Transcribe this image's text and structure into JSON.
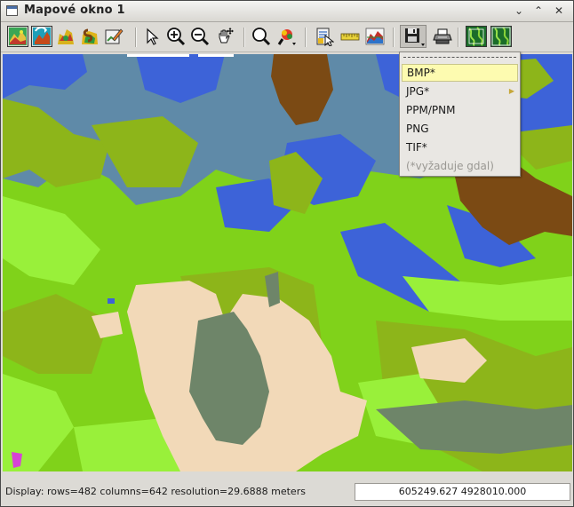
{
  "window": {
    "title": "Mapové okno 1",
    "minimize_glyph": "⌄",
    "maximize_glyph": "⌃",
    "close_glyph": "✕"
  },
  "toolbar": {
    "icons": [
      "display-map-icon",
      "redraw-icon",
      "display-vector-icon",
      "display-raster-map-icon",
      "erase-icon",
      "pointer-icon",
      "zoom-in-icon",
      "zoom-out-icon",
      "pan-icon",
      "zoom-back-icon",
      "zoom-menu-icon",
      "query-icon",
      "measure-icon",
      "profile-icon",
      "save-icon",
      "print-icon",
      "map-view-icon",
      "georectify-icon"
    ]
  },
  "export_menu": {
    "items": [
      {
        "label": "BMP*",
        "state": "active"
      },
      {
        "label": "JPG*",
        "state": "normal",
        "has_submenu": true
      },
      {
        "label": "PPM/PNM",
        "state": "normal"
      },
      {
        "label": "PNG",
        "state": "normal"
      },
      {
        "label": "TIF*",
        "state": "normal"
      },
      {
        "label": "(*vyžaduje gdal)",
        "state": "disabled"
      }
    ]
  },
  "status": {
    "text": "Display: rows=482 columns=642  resolution=29.6888 meters",
    "coordinates": "605249.627 4928010.000"
  },
  "colors": {
    "map_blue": "#3d63d8",
    "map_slate": "#5f8aa8",
    "map_brown": "#7b4a14",
    "map_olive": "#8db51a",
    "map_green": "#7fd119",
    "map_lime": "#99f03a",
    "map_tan": "#f2d9b8",
    "map_gray_green": "#6e8569",
    "map_magenta": "#d743d6",
    "menu_highlight": "#fdfbb0"
  }
}
